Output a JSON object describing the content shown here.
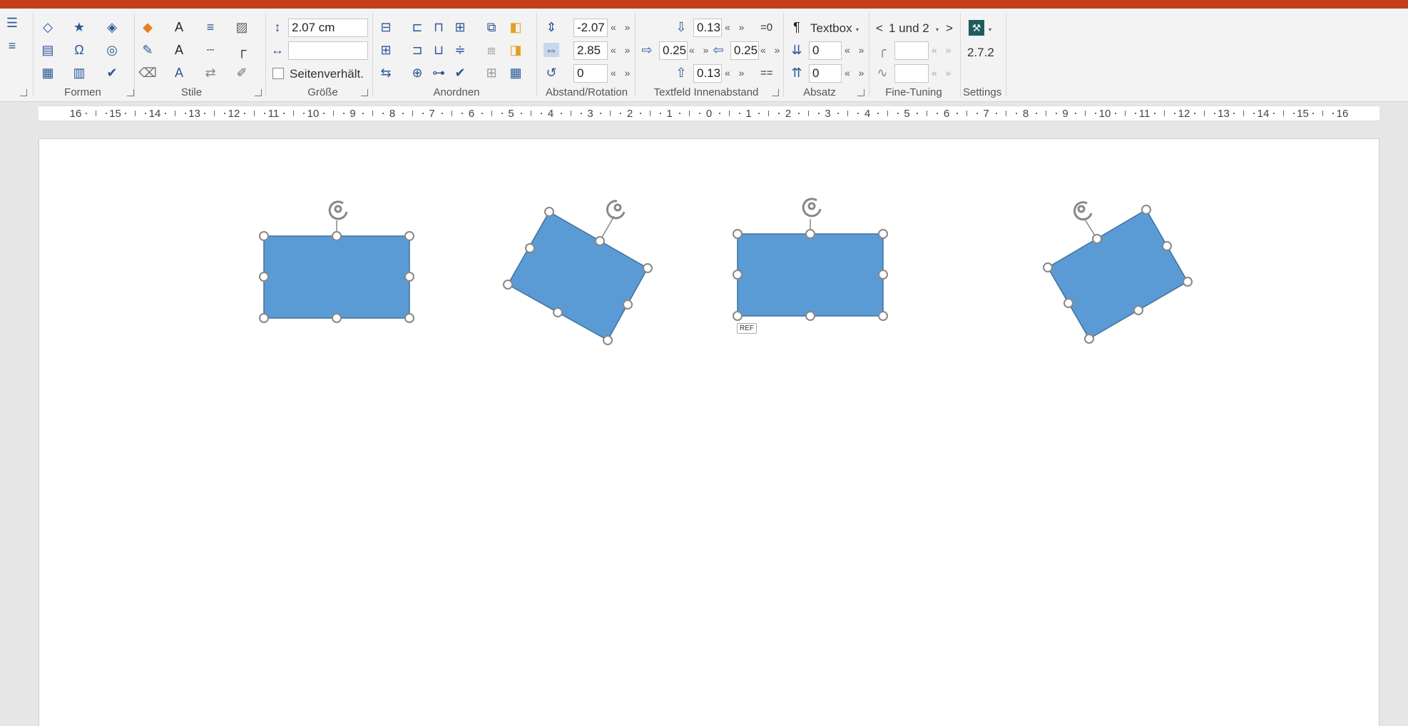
{
  "ribbon": {
    "groups": {
      "formen": "Formen",
      "stile": "Stile",
      "groesse": "Größe",
      "anordnen": "Anordnen",
      "abstand": "Abstand/Rotation",
      "textfeld": "Textfeld Innenabstand",
      "absatz": "Absatz",
      "finetuning": "Fine-Tuning",
      "settings": "Settings"
    },
    "size": {
      "height_value": "2.07  cm",
      "width_value": "",
      "aspect_label": "Seitenverhält."
    },
    "spacing": {
      "vertical": "-2.07",
      "horizontal": "2.85",
      "rotation": "0",
      "arrows": "« »"
    },
    "padding": {
      "top": "0.13",
      "left": "0.25",
      "right": "0.25",
      "bottom": "0.13",
      "arrows": "« »",
      "eq_zero": "=0",
      "eq_eq": "=="
    },
    "paragraph": {
      "textbox_label": "Textbox",
      "before": "0",
      "after": "0",
      "arrows": "« »"
    },
    "finetuning": {
      "nav_prev": "<",
      "selection": "1 und 2",
      "nav_next": ">",
      "field1": "",
      "field2": "",
      "arrows": "« »"
    },
    "settings": {
      "version": "2.7.2"
    }
  },
  "ruler": {
    "labels": [
      "16",
      "15",
      "14",
      "13",
      "12",
      "11",
      "10",
      "9",
      "8",
      "7",
      "6",
      "5",
      "4",
      "3",
      "2",
      "1",
      "0",
      "1",
      "2",
      "3",
      "4",
      "5",
      "6",
      "7",
      "8",
      "9",
      "10",
      "11",
      "12",
      "13",
      "14",
      "15",
      "16"
    ]
  },
  "slide": {
    "ref_badge": "REF",
    "shape_color": "#5b9bd5"
  },
  "colors": {
    "accent_bar": "#c43e1c",
    "icon_blue": "#2b579a",
    "shape_fill": "#5b9bd5",
    "shape_stroke": "#41719c",
    "handle_stroke": "#888888"
  }
}
